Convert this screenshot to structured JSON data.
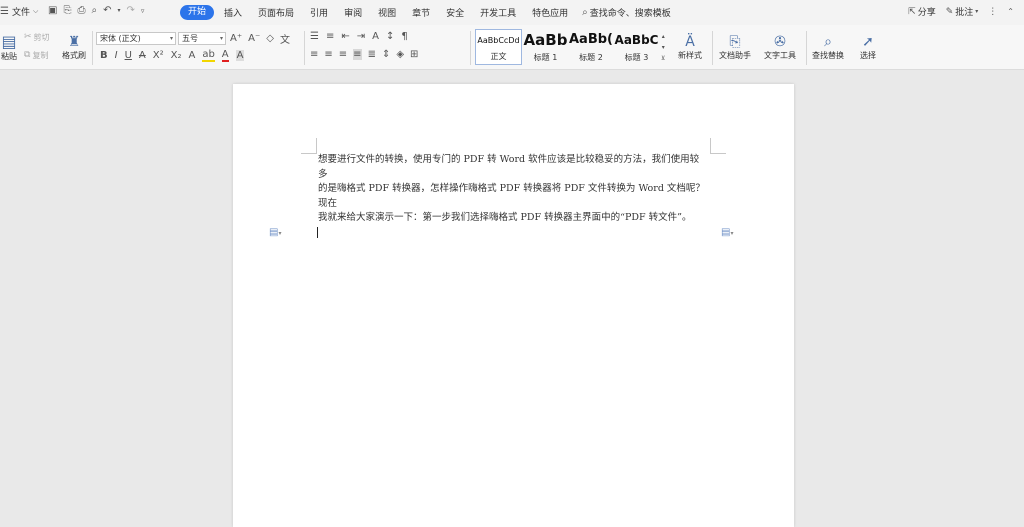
{
  "menubar": {
    "file_label": "文件",
    "tabs": [
      {
        "label": "开始",
        "active": true
      },
      {
        "label": "插入"
      },
      {
        "label": "页面布局"
      },
      {
        "label": "引用"
      },
      {
        "label": "审阅"
      },
      {
        "label": "视图"
      },
      {
        "label": "章节"
      },
      {
        "label": "安全"
      },
      {
        "label": "开发工具"
      },
      {
        "label": "特色应用"
      }
    ],
    "search_label": "查找命令、搜索模板",
    "share_label": "分享",
    "comment_label": "批注"
  },
  "ribbon": {
    "paste_label": "粘贴",
    "cut_label": "剪切",
    "copy_label": "复制",
    "format_painter_label": "格式刷",
    "font_name": "宋体 (正文)",
    "font_size": "五号",
    "styles": [
      {
        "sample": "AaBbCcDd",
        "name": "正文"
      },
      {
        "sample": "AaBb",
        "name": "标题 1"
      },
      {
        "sample": "AaBb(",
        "name": "标题 2"
      },
      {
        "sample": "AaBbC",
        "name": "标题 3"
      }
    ],
    "new_style_label": "新样式",
    "doc_helper_label": "文档助手",
    "text_tools_label": "文字工具",
    "find_replace_label": "查找替换",
    "select_label": "选择"
  },
  "document": {
    "lines": [
      "想要进行文件的转换，使用专门的 PDF 转 Word 软件应该是比较稳妥的方法，我们使用较",
      "多",
      "的是嗨格式 PDF 转换器，怎样操作嗨格式 PDF 转换器将 PDF 文件转换为 Word 文档呢？",
      "现在",
      "我就来给大家演示一下：第一步我们选择嗨格式 PDF 转换器主界面中的“PDF 转文件”。"
    ]
  },
  "colors": {
    "accent": "#2c74ea",
    "page": "#ffffff",
    "canvas": "#e9e9e9"
  }
}
